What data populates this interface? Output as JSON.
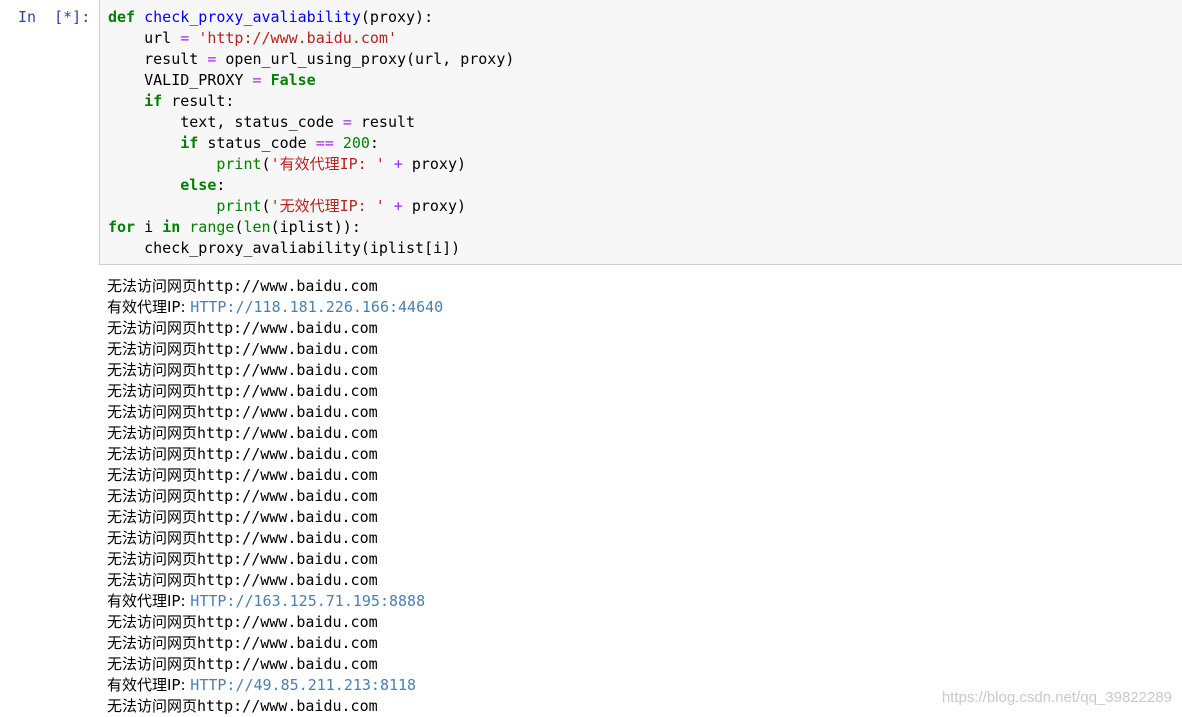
{
  "prompt_label": "In  [*]:",
  "code": {
    "line1": {
      "kw": "def",
      "fn": "check_proxy_avaliability",
      "rest": "(proxy):"
    },
    "line2": {
      "indent": "    ",
      "a": "url ",
      "op": "=",
      "sp": " ",
      "str": "'http://www.baidu.com'"
    },
    "line3": {
      "indent": "    ",
      "a": "result ",
      "op": "=",
      "b": " open_url_using_proxy(url, proxy)"
    },
    "line4": {
      "indent": "    ",
      "a": "VALID_PROXY ",
      "op": "=",
      "sp": " ",
      "kw": "False"
    },
    "line5": {
      "indent": "    ",
      "kw": "if",
      "rest": " result:"
    },
    "line6": {
      "indent": "        ",
      "a": "text, status_code ",
      "op": "=",
      "b": " result"
    },
    "line7": {
      "indent": "        ",
      "kw": "if",
      "a": " status_code ",
      "op": "==",
      "sp": " ",
      "num": "200",
      "rest": ":"
    },
    "line8": {
      "indent": "            ",
      "bi": "print",
      "p": "(",
      "str": "'有效代理IP: '",
      "sp": " ",
      "op": "+",
      "rest": " proxy)"
    },
    "line9": {
      "indent": "        ",
      "kw": "else",
      "rest": ":"
    },
    "line10": {
      "indent": "            ",
      "bi": "print",
      "p": "(",
      "str": "'无效代理IP: '",
      "sp": " ",
      "op": "+",
      "rest": " proxy)"
    },
    "line11": {
      "kw1": "for",
      "a": " i ",
      "kw2": "in",
      "sp": " ",
      "bi1": "range",
      "p": "(",
      "bi2": "len",
      "rest": "(iplist)):"
    },
    "line12": {
      "indent": "    ",
      "a": "check_proxy_avaliability(iplist[i])"
    }
  },
  "output": [
    {
      "cn": "无法访问网页",
      "text": "http://www.baidu.com",
      "url": ""
    },
    {
      "cn": "有效代理IP: ",
      "text": "",
      "url": "HTTP://118.181.226.166:44640"
    },
    {
      "cn": "无法访问网页",
      "text": "http://www.baidu.com",
      "url": ""
    },
    {
      "cn": "无法访问网页",
      "text": "http://www.baidu.com",
      "url": ""
    },
    {
      "cn": "无法访问网页",
      "text": "http://www.baidu.com",
      "url": ""
    },
    {
      "cn": "无法访问网页",
      "text": "http://www.baidu.com",
      "url": ""
    },
    {
      "cn": "无法访问网页",
      "text": "http://www.baidu.com",
      "url": ""
    },
    {
      "cn": "无法访问网页",
      "text": "http://www.baidu.com",
      "url": ""
    },
    {
      "cn": "无法访问网页",
      "text": "http://www.baidu.com",
      "url": ""
    },
    {
      "cn": "无法访问网页",
      "text": "http://www.baidu.com",
      "url": ""
    },
    {
      "cn": "无法访问网页",
      "text": "http://www.baidu.com",
      "url": ""
    },
    {
      "cn": "无法访问网页",
      "text": "http://www.baidu.com",
      "url": ""
    },
    {
      "cn": "无法访问网页",
      "text": "http://www.baidu.com",
      "url": ""
    },
    {
      "cn": "无法访问网页",
      "text": "http://www.baidu.com",
      "url": ""
    },
    {
      "cn": "无法访问网页",
      "text": "http://www.baidu.com",
      "url": ""
    },
    {
      "cn": "有效代理IP: ",
      "text": "",
      "url": "HTTP://163.125.71.195:8888"
    },
    {
      "cn": "无法访问网页",
      "text": "http://www.baidu.com",
      "url": ""
    },
    {
      "cn": "无法访问网页",
      "text": "http://www.baidu.com",
      "url": ""
    },
    {
      "cn": "无法访问网页",
      "text": "http://www.baidu.com",
      "url": ""
    },
    {
      "cn": "有效代理IP: ",
      "text": "",
      "url": "HTTP://49.85.211.213:8118"
    },
    {
      "cn": "无法访问网页",
      "text": "http://www.baidu.com",
      "url": ""
    }
  ],
  "watermark": "https://blog.csdn.net/qq_39822289",
  "colors": {
    "prompt": "#303f9f",
    "keyword": "#008000",
    "function_name": "#0000ff",
    "string": "#ba2121",
    "operator": "#aa22ff",
    "output_url": "#4a7fb0",
    "cell_background": "#f7f7f7"
  }
}
